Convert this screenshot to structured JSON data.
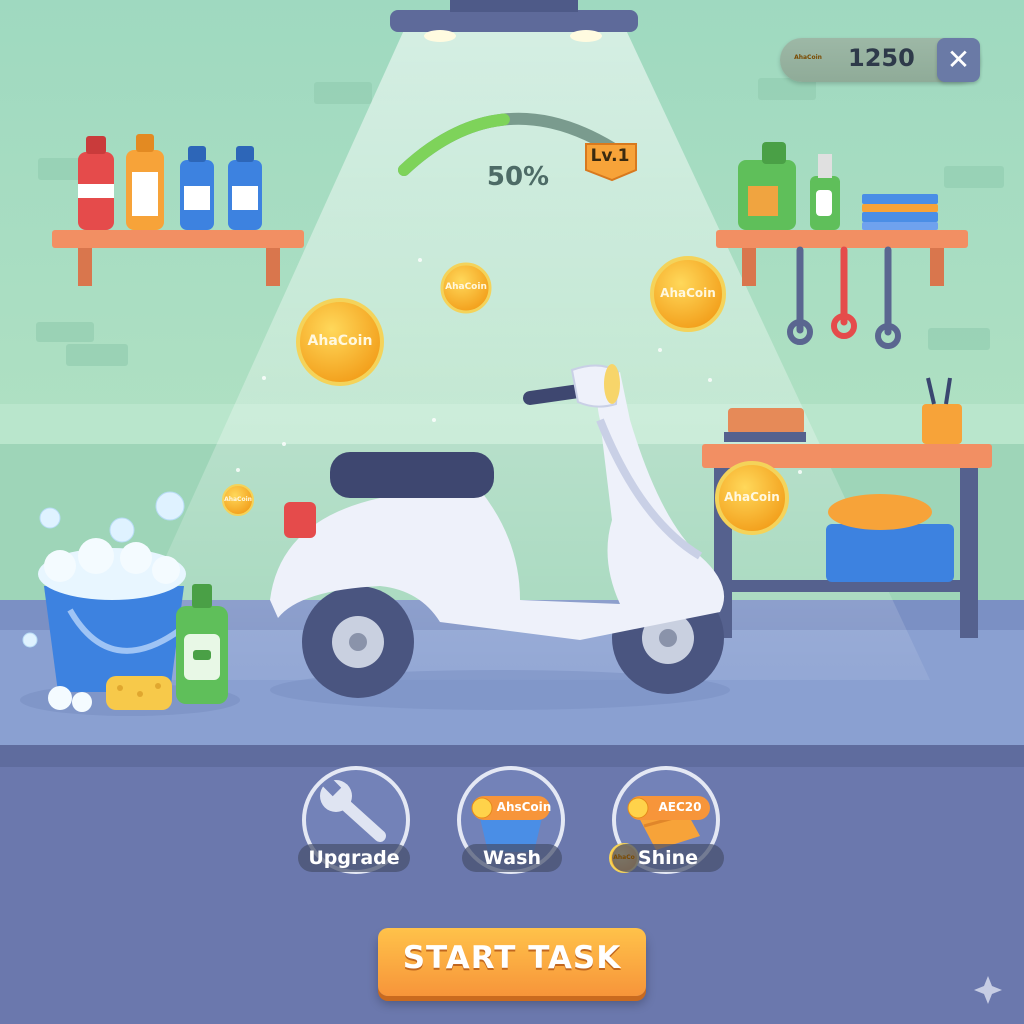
{
  "hud": {
    "coin_icon": "coin-icon",
    "coin_icon_text": "AhaCoin",
    "coin_count": "1250",
    "close_label": "✕"
  },
  "progress": {
    "percent_label": "50%",
    "percent_value": 0.5,
    "level_label": "Lv.1",
    "fill_color": "#7ed35a",
    "track_color": "#7a9b8e"
  },
  "coins": [
    {
      "label": "AhaCoin"
    },
    {
      "label": "AhaCoin"
    },
    {
      "label": "AhaCoin"
    },
    {
      "label": "AhaCoin"
    },
    {
      "label": "AhaCoin"
    }
  ],
  "actions": [
    {
      "label": "Upgrade",
      "icon": "wrench-icon"
    },
    {
      "label": "Wash",
      "icon": "bucket-icon",
      "badge": "AhsCoin"
    },
    {
      "label": "Shine",
      "icon": "cloth-icon",
      "badge": "AEC20",
      "coin_icon_text": "AhaCo"
    }
  ],
  "start_button": {
    "label": "START TASK"
  },
  "colors": {
    "wall": "#a8dcc0",
    "floor": "#8a9fd0",
    "panel": "#6b78ad",
    "accent": "#f7953a",
    "coin": "#f9bd2a"
  }
}
